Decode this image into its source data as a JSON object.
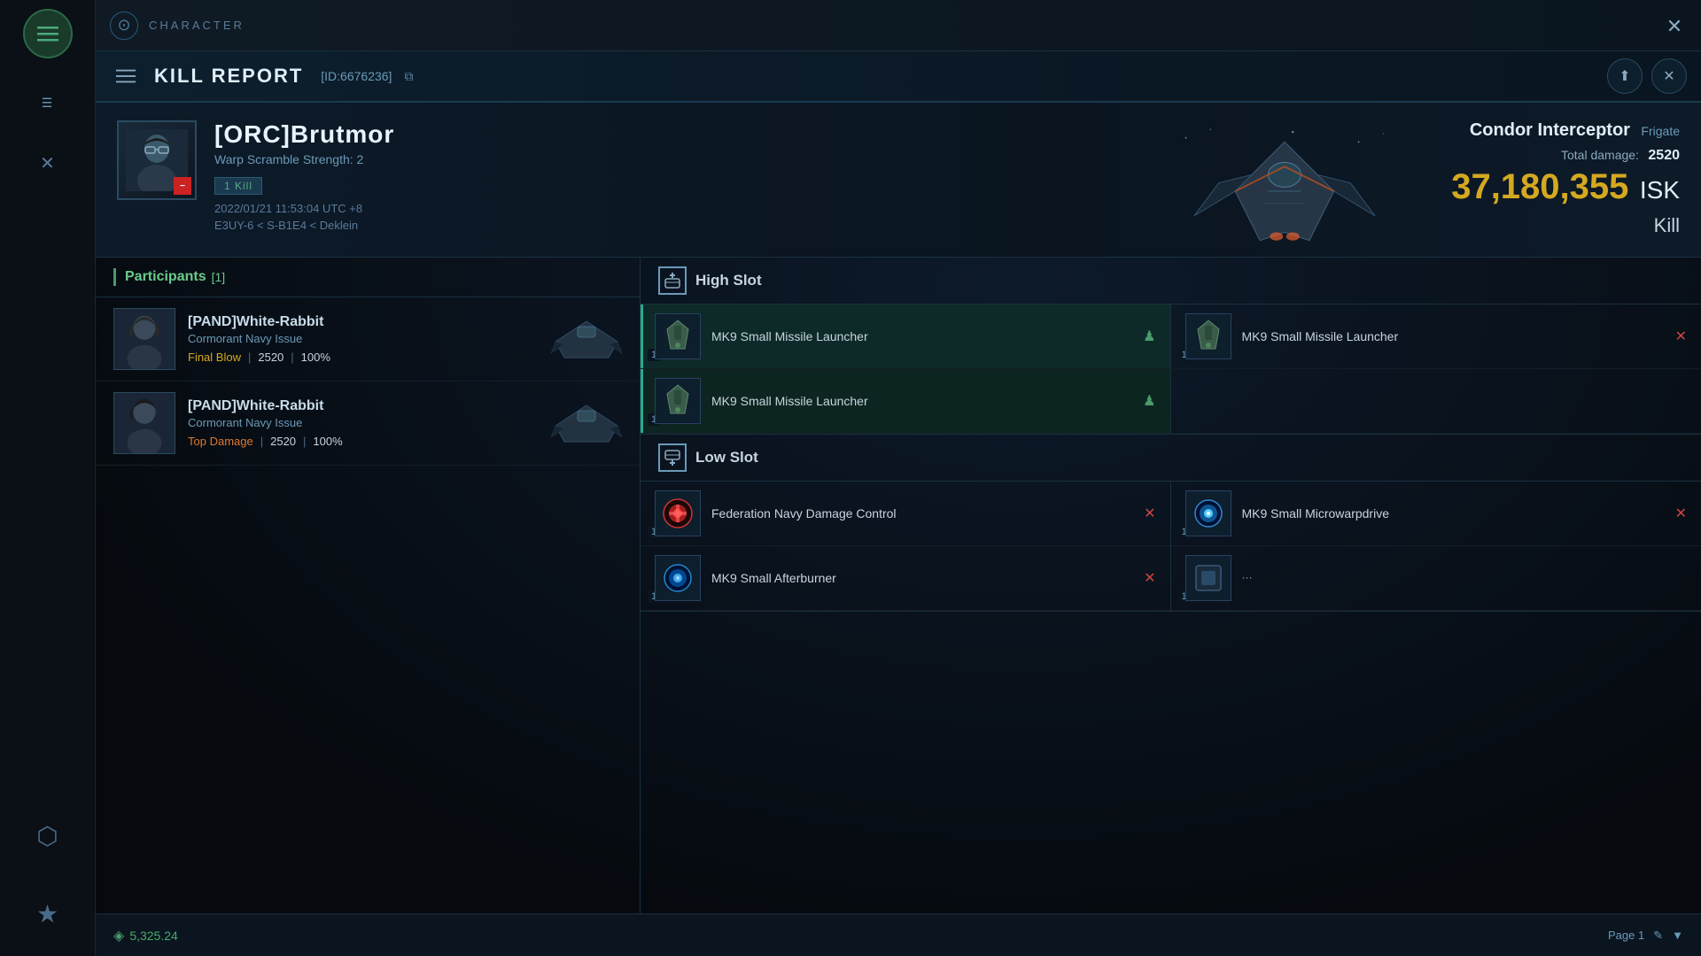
{
  "sidebar": {
    "hamburger_label": "☰",
    "items": [
      {
        "name": "hamburger-top",
        "icon": "☰"
      },
      {
        "name": "character",
        "icon": "✕"
      },
      {
        "name": "star",
        "icon": "★"
      }
    ]
  },
  "top_bar": {
    "character_label": "CHARACTER"
  },
  "main_close_label": "✕",
  "kill_report": {
    "menu_icon": "☰",
    "title": "KILL REPORT",
    "id": "[ID:6676236]",
    "export_icon": "⬆",
    "close_icon": "✕",
    "victim": {
      "name": "[ORC]Brutmor",
      "warp_scramble": "Warp Scramble Strength: 2",
      "kill_badge": "1 Kill",
      "datetime": "2022/01/21 11:53:04 UTC +8",
      "location": "E3UY-6 < S-B1E4 < Deklein"
    },
    "ship": {
      "name": "Condor Interceptor",
      "type": "Frigate",
      "total_damage_label": "Total damage:",
      "total_damage_value": "2520",
      "isk_value": "37,180,355",
      "isk_label": "ISK",
      "outcome": "Kill"
    },
    "participants": {
      "title": "Participants",
      "count": "[1]",
      "items": [
        {
          "name": "[PAND]White-Rabbit",
          "ship": "Cormorant Navy Issue",
          "stat_label": "Final Blow",
          "damage": "2520",
          "percent": "100%"
        },
        {
          "name": "[PAND]White-Rabbit",
          "ship": "Cormorant Navy Issue",
          "stat_label": "Top Damage",
          "damage": "2520",
          "percent": "100%"
        }
      ]
    },
    "high_slot": {
      "title": "High Slot",
      "modules": [
        {
          "qty": 1,
          "name": "MK9 Small Missile Launcher",
          "highlight": true,
          "has_person": true
        },
        {
          "qty": 1,
          "name": "MK9 Small Missile Launcher",
          "highlight": false,
          "has_person": false,
          "has_x": true
        },
        {
          "qty": 1,
          "name": "MK9 Small Missile Launcher",
          "highlight": true,
          "has_person": true
        }
      ]
    },
    "low_slot": {
      "title": "Low Slot",
      "modules": [
        {
          "qty": 1,
          "name": "Federation Navy Damage Control",
          "highlight": false,
          "has_x": true,
          "type": "damage-control"
        },
        {
          "qty": 1,
          "name": "MK9 Small Microwarpdrive",
          "highlight": false,
          "has_x": true,
          "type": "microwarpdrive"
        },
        {
          "qty": 1,
          "name": "MK9 Small Afterburner",
          "highlight": false,
          "has_x": true,
          "type": "afterburner"
        }
      ]
    },
    "bottom": {
      "balance": "5,325.24",
      "page": "Page 1",
      "edit_icon": "✎",
      "filter_icon": "▼"
    }
  }
}
